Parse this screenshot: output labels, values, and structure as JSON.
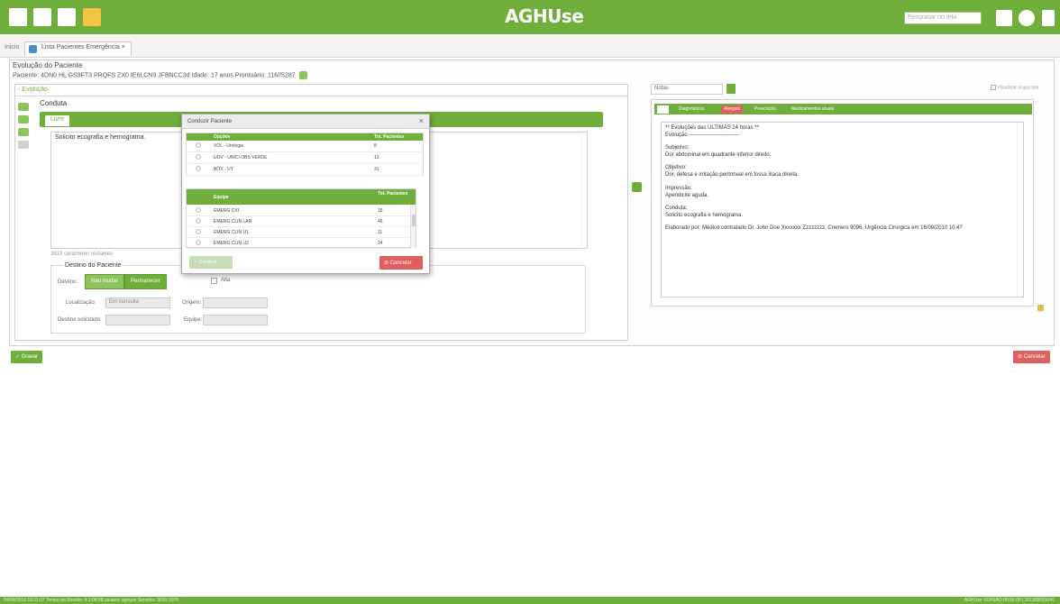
{
  "header": {
    "app_title": "AGHUse",
    "search_placeholder": "Pesquisar no tela",
    "left_icons": [
      "menu-icon",
      "favorites-icon",
      "grid-icon",
      "logo-icon"
    ],
    "right_icons": [
      "apps-icon",
      "user-icon",
      "logout-icon"
    ],
    "color": "#6fae3a"
  },
  "tabs": {
    "home": "Inicio",
    "active": "Lista Pacientes Emergência ×"
  },
  "form": {
    "title": "Evolução do Paciente",
    "patient_line": "Paciente: 4DN0 HL GS9FT3 PRQFS ZX0 IE6LCN9 JFBNCC3d  Idade: 17 anos  Prontuário: 116//5287",
    "section_toggle": "- Evolução",
    "conduta_label": "Conduta",
    "editor_tab": "Livre",
    "editor_text": "Solicito ecografia e hemograma.",
    "chars_remaining": "3819 caracteres restantes",
    "destino": {
      "title": "Destino do Paciente",
      "destino_label": "Destino:",
      "btn_nao": "Nao mudar",
      "btn_permanecer": "Permanecer",
      "alta_label": "Alta",
      "localizacao_label": "Localização:",
      "localizacao_value": "Em consulta",
      "origem_label": "Origem:",
      "destino_solicitado_label": "Destino solicitado:",
      "equipe_label": "Equipe:"
    }
  },
  "right": {
    "select_value": "Notas",
    "visualizar_label": "Visualizar ocupa tela",
    "tabs": [
      "Diagnósticos",
      "Alergias",
      "Prescrição",
      "Medicamentos atuais"
    ],
    "evolution_lines": [
      "** Evoluções das ÚLTIMAS 24 horas **",
      "Evolução ----------------------------",
      "",
      "Subjetivo:",
      "Dor abdominal em quadrante inferior direito.",
      "",
      "Objetivo:",
      "Dor, defesa e irritação peritoneal em fossa ilíaca direita.",
      "",
      "Impressão:",
      "Apendicite aguda.",
      "",
      "Conduta:",
      "Solicito ecografia e hemograma.",
      "",
      "Elaborado por: Médico contratado Dr. John Doe Xxxxxxx Zzzzzzzz, Cremers 9096, Urgência Cirúrgica em 16/09/2010 10:47"
    ]
  },
  "modal": {
    "title": "Conduzir Paciente",
    "close": "×",
    "specialties": {
      "headers": [
        "Opções",
        "Tot. Pacientes"
      ],
      "rows": [
        {
          "name": "VOL - Urologia",
          "count": "8"
        },
        {
          "name": "UOV - UNICI OBS VERDE",
          "count": "13"
        },
        {
          "name": "BOX - UY",
          "count": "31"
        }
      ]
    },
    "teams": {
      "headers": [
        "Equipe",
        "Tot. Pacientes"
      ],
      "rows": [
        {
          "name": "EMERG CXI",
          "count": "15"
        },
        {
          "name": "EMERG CLIN LAR",
          "count": "46"
        },
        {
          "name": "EMERG CLIN U1",
          "count": "11"
        },
        {
          "name": "EMERG CLIN U2",
          "count": "24"
        }
      ]
    },
    "btn_conduzir": "✓ Conduzir",
    "btn_cancelar": "⊘ Cancelar"
  },
  "actions": {
    "gravar": "✓ Gravar",
    "cancelar": "⊘ Cancelar"
  },
  "footer": {
    "left": "04/09/2019 16:11:07   Tempo da Sessão: 4:1:08:08  usuario: aghuse    Servidor: 3600-2075",
    "right": "AGHUse   VERSÃO 00.00.00 | 201909091045"
  }
}
